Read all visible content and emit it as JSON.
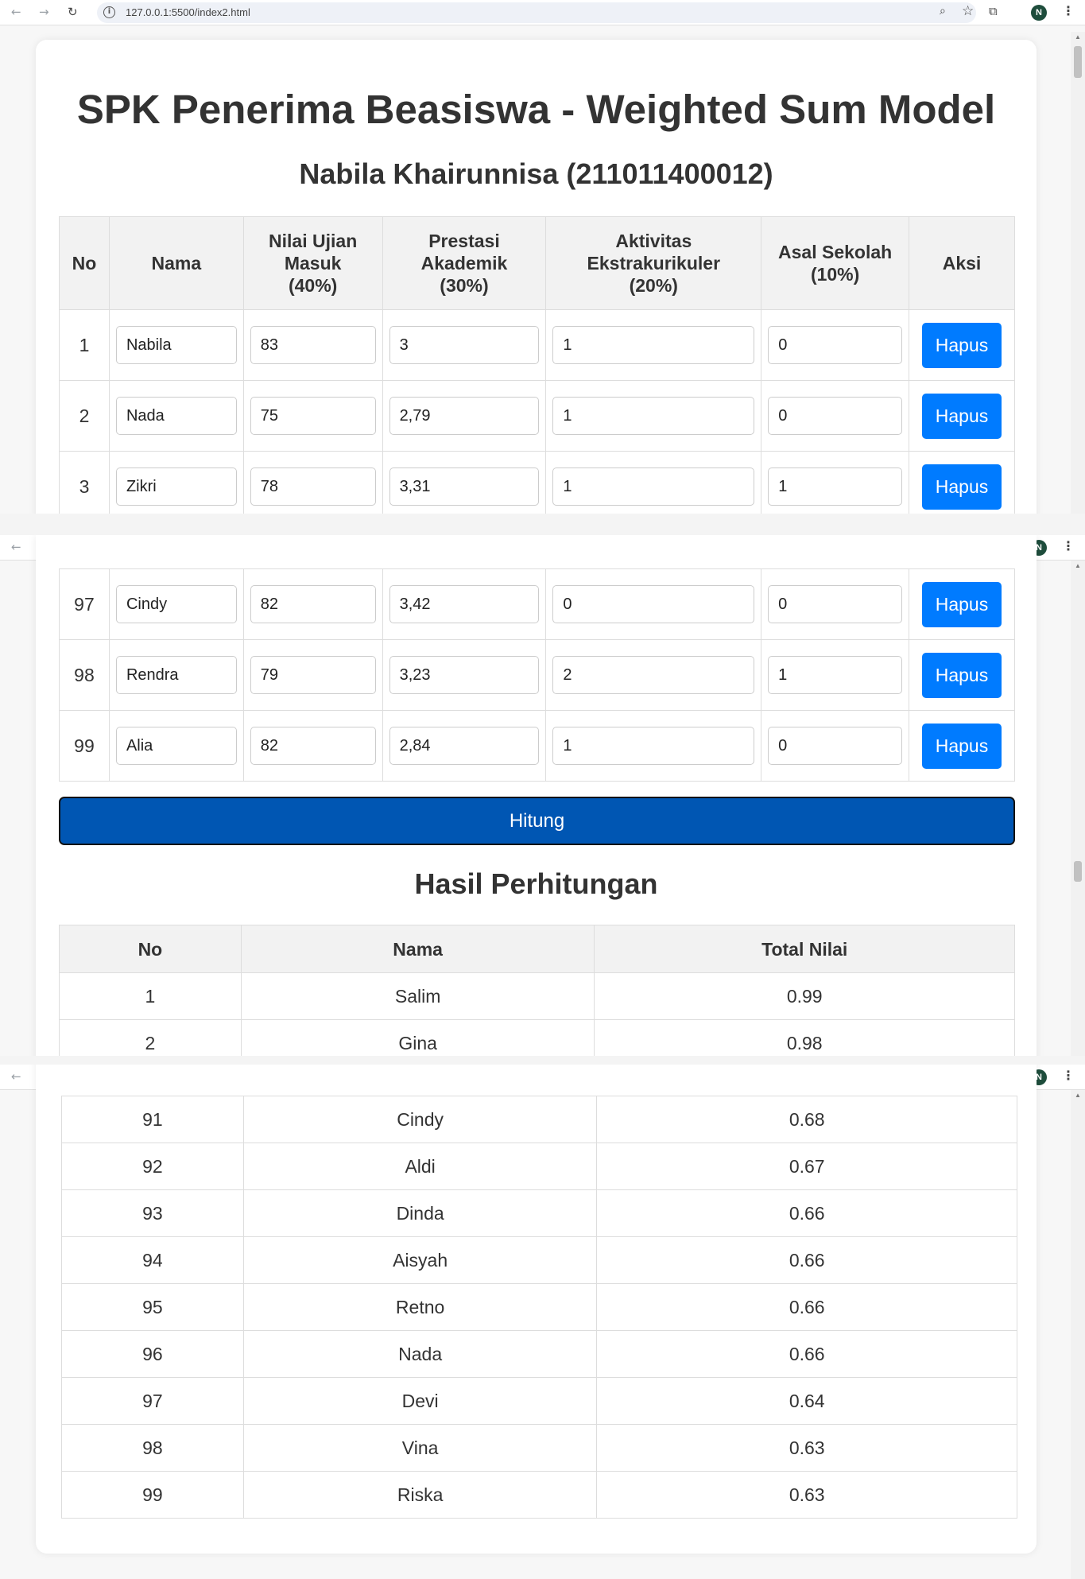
{
  "browser": {
    "url": "127.0.0.1:5500/index2.html",
    "avatar_initial": "N"
  },
  "page": {
    "title": "SPK Penerima Beasiswa - Weighted Sum Model",
    "subtitle": "Nabila Khairunnisa (211011400012)"
  },
  "input_table": {
    "headers": {
      "no": "No",
      "nama": "Nama",
      "nilai_ujian_line1": "Nilai Ujian",
      "nilai_ujian_line2": "Masuk",
      "nilai_ujian_line3": "(40%)",
      "prestasi_line1": "Prestasi",
      "prestasi_line2": "Akademik",
      "prestasi_line3": "(30%)",
      "aktivitas_line1": "Aktivitas",
      "aktivitas_line2": "Ekstrakurikuler",
      "aktivitas_line3": "(20%)",
      "asal_line1": "Asal Sekolah",
      "asal_line2": "(10%)",
      "aksi": "Aksi"
    },
    "rows_top": [
      {
        "no": "1",
        "nama": "Nabila",
        "nilai": "83",
        "prestasi": "3",
        "aktivitas": "1",
        "asal": "0"
      },
      {
        "no": "2",
        "nama": "Nada",
        "nilai": "75",
        "prestasi": "2,79",
        "aktivitas": "1",
        "asal": "0"
      },
      {
        "no": "3",
        "nama": "Zikri",
        "nilai": "78",
        "prestasi": "3,31",
        "aktivitas": "1",
        "asal": "1"
      }
    ],
    "rows_bottom": [
      {
        "no": "97",
        "nama": "Cindy",
        "nilai": "82",
        "prestasi": "3,42",
        "aktivitas": "0",
        "asal": "0"
      },
      {
        "no": "98",
        "nama": "Rendra",
        "nilai": "79",
        "prestasi": "3,23",
        "aktivitas": "2",
        "asal": "1"
      },
      {
        "no": "99",
        "nama": "Alia",
        "nilai": "82",
        "prestasi": "2,84",
        "aktivitas": "1",
        "asal": "0"
      }
    ],
    "delete_label": "Hapus"
  },
  "hitung_label": "Hitung",
  "results": {
    "title": "Hasil Perhitungan",
    "headers": {
      "no": "No",
      "nama": "Nama",
      "total": "Total Nilai"
    },
    "rows_top": [
      {
        "no": "1",
        "nama": "Salim",
        "total": "0.99"
      },
      {
        "no": "2",
        "nama": "Gina",
        "total": "0.98"
      }
    ],
    "rows_bottom": [
      {
        "no": "91",
        "nama": "Cindy",
        "total": "0.68"
      },
      {
        "no": "92",
        "nama": "Aldi",
        "total": "0.67"
      },
      {
        "no": "93",
        "nama": "Dinda",
        "total": "0.66"
      },
      {
        "no": "94",
        "nama": "Aisyah",
        "total": "0.66"
      },
      {
        "no": "95",
        "nama": "Retno",
        "total": "0.66"
      },
      {
        "no": "96",
        "nama": "Nada",
        "total": "0.66"
      },
      {
        "no": "97",
        "nama": "Devi",
        "total": "0.64"
      },
      {
        "no": "98",
        "nama": "Vina",
        "total": "0.63"
      },
      {
        "no": "99",
        "nama": "Riska",
        "total": "0.63"
      }
    ]
  }
}
